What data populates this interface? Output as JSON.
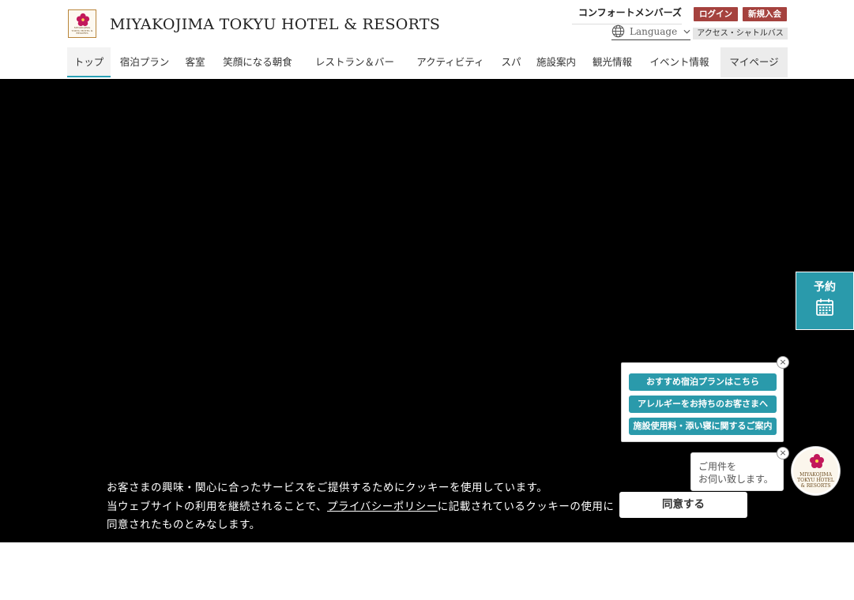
{
  "header": {
    "brand": "MIYAKOJIMA TOKYU HOTEL & RESORTS",
    "logo_text": "MIYAKOJIMA TOKYU HOTEL & RESORTS",
    "comfort_members": "コンフォートメンバーズ",
    "login": "ログイン",
    "signup": "新規入会",
    "language": "Language",
    "access": "アクセス・シャトルバス"
  },
  "nav": {
    "items": [
      {
        "label": "トップ"
      },
      {
        "label": "宿泊プラン"
      },
      {
        "label": "客室"
      },
      {
        "label": "笑顔になる朝食"
      },
      {
        "label": "レストラン＆バー"
      },
      {
        "label": "アクティビティ"
      },
      {
        "label": "スパ"
      },
      {
        "label": "施設案内"
      },
      {
        "label": "観光情報"
      },
      {
        "label": "イベント情報"
      },
      {
        "label": "マイページ"
      }
    ]
  },
  "reserve": {
    "label": "予約"
  },
  "float_links": {
    "items": [
      {
        "label": "おすすめ宿泊プランはこちら"
      },
      {
        "label": "アレルギーをお持ちのお客さまへ"
      },
      {
        "label": "施設使用料・添い寝に関するご案内"
      }
    ],
    "close": "×"
  },
  "chat": {
    "line1": "ご用件を",
    "line2": "お伺い致します。",
    "close": "×"
  },
  "cookie": {
    "line1": "お客さまの興味・関心に合ったサービスをご提供するためにクッキーを使用しています。",
    "line2_pre": "当ウェブサイトの利用を継続されることで、",
    "line2_link": "プライバシーポリシー",
    "line2_post": "に記載されているクッキーの使用に",
    "line3": "同意されたものとみなします。",
    "agree": "同意する"
  },
  "colors": {
    "accent": "#2a9aab",
    "brand_red": "#a5423e",
    "hero_bg": "#000000"
  }
}
